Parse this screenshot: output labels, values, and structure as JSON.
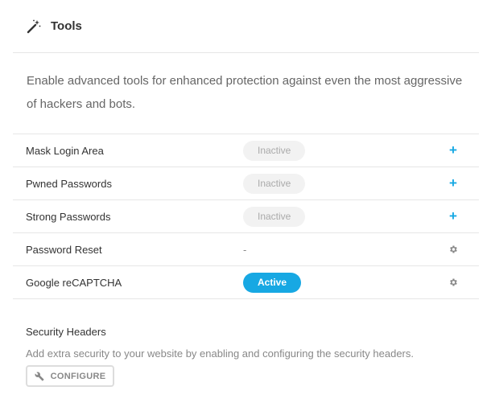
{
  "header": {
    "title": "Tools",
    "icon": "magic-wand-icon"
  },
  "intro": "Enable advanced tools for enhanced protection against even the most aggressive of hackers and bots.",
  "tools": [
    {
      "name": "Mask Login Area",
      "status": "Inactive",
      "action_icon": "plus-icon"
    },
    {
      "name": "Pwned Passwords",
      "status": "Inactive",
      "action_icon": "plus-icon"
    },
    {
      "name": "Strong Passwords",
      "status": "Inactive",
      "action_icon": "plus-icon"
    },
    {
      "name": "Password Reset",
      "status": "-",
      "action_icon": "gear-icon"
    },
    {
      "name": "Google reCAPTCHA",
      "status": "Active",
      "action_icon": "gear-icon"
    }
  ],
  "security_headers": {
    "title": "Security Headers",
    "description": "Add extra security to your website by enabling and configuring the security headers.",
    "button_label": "CONFIGURE",
    "button_icon": "wrench-icon"
  },
  "colors": {
    "accent": "#17a8e3",
    "inactive_bg": "#f2f2f2",
    "border": "#e6e6e6"
  }
}
